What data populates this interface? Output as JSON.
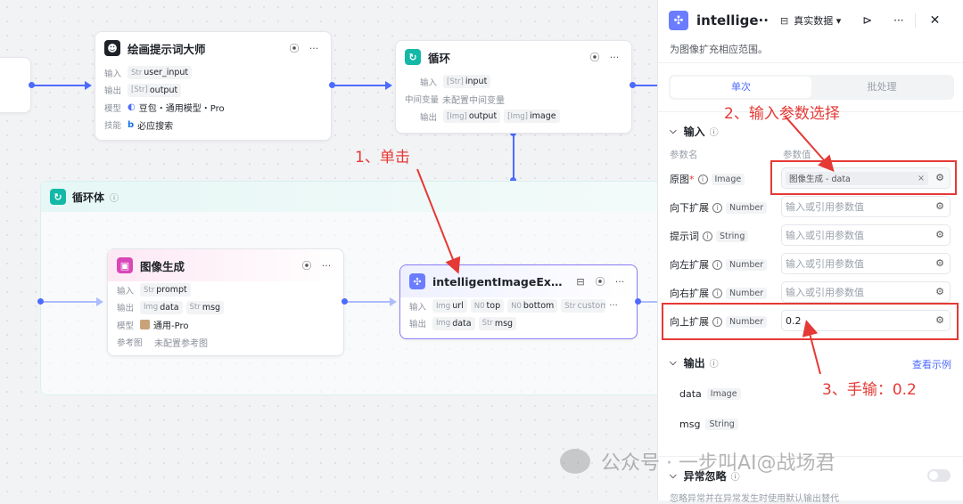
{
  "nodes": {
    "prompt_master": {
      "title": "绘画提示词大师",
      "rows": [
        {
          "label": "输入",
          "chips": [
            {
              "type": "Str",
              "text": "user_input"
            }
          ]
        },
        {
          "label": "输出",
          "chips": [
            {
              "type": "[Str]",
              "text": "output"
            }
          ]
        },
        {
          "label": "模型",
          "value": "豆包・通用模型・Pro"
        },
        {
          "label": "技能",
          "value": "必应搜索"
        }
      ]
    },
    "loop": {
      "title": "循环",
      "rows": [
        {
          "label": "输入",
          "chips": [
            {
              "type": "[Str]",
              "text": "input"
            }
          ]
        },
        {
          "label": "中间变量",
          "value": "未配置中间变量"
        },
        {
          "label": "输出",
          "chips": [
            {
              "type": "[Img]",
              "text": "output"
            },
            {
              "type": "[Img]",
              "text": "image"
            }
          ]
        }
      ]
    },
    "loop_body": {
      "title": "循环体",
      "info": "ⓘ"
    },
    "image_gen": {
      "title": "图像生成",
      "rows": [
        {
          "label": "输入",
          "chips": [
            {
              "type": "Str",
              "text": "prompt"
            }
          ]
        },
        {
          "label": "输出",
          "chips": [
            {
              "type": "Img",
              "text": "data"
            },
            {
              "type": "Str",
              "text": "msg"
            }
          ]
        },
        {
          "label": "模型",
          "value": "通用-Pro"
        },
        {
          "label": "参考图",
          "value": "未配置参考图"
        }
      ]
    },
    "expansion": {
      "title": "intelligentImageExpansion",
      "rows": [
        {
          "label": "输入",
          "chips": [
            {
              "type": "Img",
              "text": "url"
            },
            {
              "type": "N0",
              "text": "top"
            },
            {
              "type": "N0",
              "text": "bottom"
            },
            {
              "type": "Str",
              "text": "custom_pr"
            }
          ]
        },
        {
          "label": "输出",
          "chips": [
            {
              "type": "Img",
              "text": "data"
            },
            {
              "type": "Str",
              "text": "msg"
            }
          ]
        }
      ]
    }
  },
  "panel": {
    "title": "intellige···",
    "data_mode": "真实数据",
    "description": "为图像扩充相应范围。",
    "tabs": [
      "单次",
      "批处理"
    ],
    "input_section": "输入",
    "col_name": "参数名",
    "col_value": "参数值",
    "params": [
      {
        "name": "原图",
        "required": "*",
        "type": "Image",
        "value": "图像生成 - data",
        "placeholder": ""
      },
      {
        "name": "向下扩展",
        "required": "",
        "type": "Number",
        "value": "",
        "placeholder": "输入或引用参数值"
      },
      {
        "name": "提示词",
        "required": "",
        "type": "String",
        "value": "",
        "placeholder": "输入或引用参数值"
      },
      {
        "name": "向左扩展",
        "required": "",
        "type": "Number",
        "value": "",
        "placeholder": "输入或引用参数值"
      },
      {
        "name": "向右扩展",
        "required": "",
        "type": "Number",
        "value": "",
        "placeholder": "输入或引用参数值"
      },
      {
        "name": "向上扩展",
        "required": "",
        "type": "Number",
        "value": "0.2",
        "placeholder": ""
      }
    ],
    "output_section": "输出",
    "view_example": "查看示例",
    "outputs": [
      {
        "name": "data",
        "type": "Image"
      },
      {
        "name": "msg",
        "type": "String"
      }
    ],
    "exception_section": "异常忽略",
    "exception_desc": "忽略异常并在异常发生时使用默认输出替代"
  },
  "annotations": {
    "step1": "1、单击",
    "step2": "2、输入参数选择",
    "step3": "3、手输：0.2"
  },
  "watermark": "公众号 · 一步叫AI@战场君",
  "colors": {
    "accent": "#4d6bfe",
    "annotation": "#e53935"
  }
}
